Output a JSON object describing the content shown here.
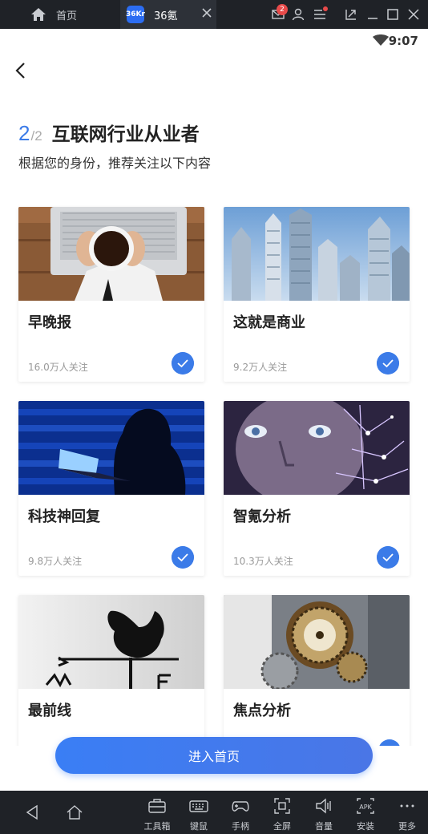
{
  "window": {
    "home_tab_label": "首页",
    "app_tab_label": "36氪",
    "app_logo_text": "36Kr",
    "mail_badge": "2"
  },
  "statusbar": {
    "time": "9:07"
  },
  "header": {
    "step_current": "2",
    "step_total": "/2",
    "title": "互联网行业从业者",
    "subtitle": "根据您的身份，推荐关注以下内容"
  },
  "cards": [
    {
      "title": "早晚报",
      "followers": "16.0万人关注",
      "selected": true,
      "image": "coffee-laptop-photo"
    },
    {
      "title": "这就是商业",
      "followers": "9.2万人关注",
      "selected": true,
      "image": "skyscrapers-photo"
    },
    {
      "title": "科技神回复",
      "followers": "9.8万人关注",
      "selected": true,
      "image": "hacker-binary-photo"
    },
    {
      "title": "智氪分析",
      "followers": "10.3万人关注",
      "selected": true,
      "image": "face-circuit-photo"
    },
    {
      "title": "最前线",
      "followers": "",
      "selected": true,
      "image": "weathervane-rooster-photo"
    },
    {
      "title": "焦点分析",
      "followers": "",
      "selected": true,
      "image": "gears-photo"
    }
  ],
  "enter_button": "进入首页",
  "toolbar": {
    "items": [
      {
        "label": "工具箱",
        "icon": "toolbox-icon"
      },
      {
        "label": "键鼠",
        "icon": "keyboard-icon"
      },
      {
        "label": "手柄",
        "icon": "gamepad-icon"
      },
      {
        "label": "全屏",
        "icon": "fullscreen-icon"
      },
      {
        "label": "音量",
        "icon": "volume-icon"
      },
      {
        "label": "安装",
        "icon": "apk-icon"
      },
      {
        "label": "更多",
        "icon": "more-icon"
      }
    ]
  },
  "colors": {
    "accent": "#3b7be8",
    "dark_bar": "#1f2227"
  }
}
